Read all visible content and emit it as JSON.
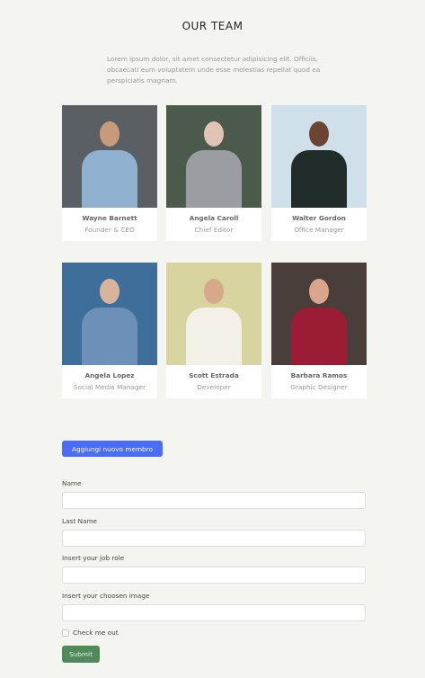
{
  "header": {
    "title": "OUR TEAM",
    "intro": "Lorem ipsum dolor, sit amet consectetur adipisicing elit. Officiis, obcaecati eum voluptatem unde esse molestias repellat quod ea perspiciatis magnam."
  },
  "team": [
    {
      "name": "Wayne Barnett",
      "role": "Founder & CEO",
      "bg": "#5a5f63",
      "shirt": "#8fb0cf",
      "skin": "#c79a7c"
    },
    {
      "name": "Angela Caroll",
      "role": "Chief Editor",
      "bg": "#4b5a4a",
      "shirt": "#9a9ea3",
      "skin": "#e0c4b5"
    },
    {
      "name": "Walter Gordon",
      "role": "Office Manager",
      "bg": "#cfe0ea",
      "shirt": "#1f2c2a",
      "skin": "#6b4532"
    },
    {
      "name": "Angela Lopez",
      "role": "Social Media Manager",
      "bg": "#3e6f9a",
      "shirt": "#6c90b8",
      "skin": "#d9b49c"
    },
    {
      "name": "Scott Estrada",
      "role": "Developer",
      "bg": "#d8d4a0",
      "shirt": "#f3f0e8",
      "skin": "#d6a98a"
    },
    {
      "name": "Barbara Ramos",
      "role": "Graphic Designer",
      "bg": "#4a3e3a",
      "shirt": "#9a1d35",
      "skin": "#d9a68c"
    }
  ],
  "form": {
    "add_button": "Aggiungi nuovo membro",
    "name_label": "Name",
    "lastname_label": "Last Name",
    "role_label": "Insert your job role",
    "image_label": "Insert your choosen image",
    "check_label": "Check me out",
    "submit": "Submit"
  },
  "colors": {
    "primary": "#4a6cf7",
    "success": "#4f8a5b",
    "background": "#f4f4f0"
  }
}
